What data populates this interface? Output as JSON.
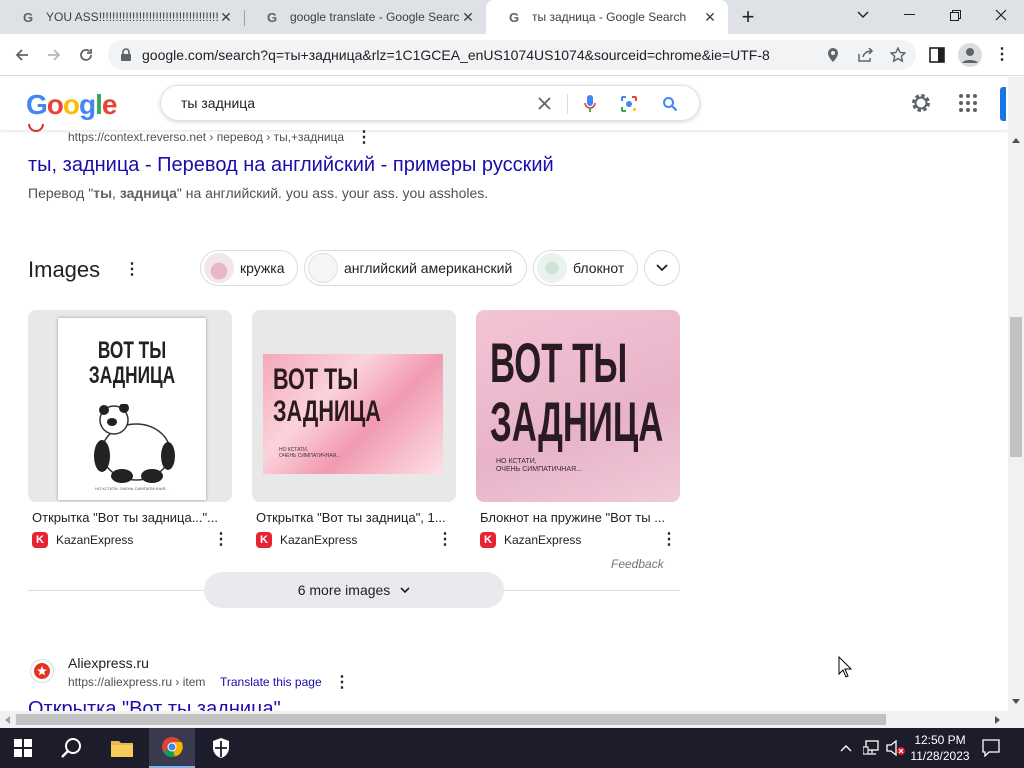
{
  "browser": {
    "tabs": [
      {
        "title": "YOU ASS!!!!!!!!!!!!!!!!!!!!!!!!!!!!!!!!!!!!!",
        "favicon": "G",
        "active": false
      },
      {
        "title": "google translate - Google Search",
        "favicon": "G",
        "active": false
      },
      {
        "title": "ты задница - Google Search",
        "favicon": "G",
        "active": true
      }
    ],
    "new_tab_label": "+",
    "url": "google.com/search?q=ты+задница&rlz=1C1GCEA_enUS1074US1074&sourceid=chrome&ie=UTF-8"
  },
  "google": {
    "logo": [
      "G",
      "o",
      "o",
      "g",
      "l",
      "e"
    ],
    "logo_colors": [
      "#4285F4",
      "#EA4335",
      "#FBBC05",
      "#4285F4",
      "#34A853",
      "#EA4335"
    ],
    "query": "ты задница"
  },
  "results": {
    "reverso": {
      "url": "https://context.reverso.net › перевод › ты,+задница",
      "title": "ты, задница - Перевод на английский - примеры русский",
      "snippet_pre": "Перевод \"",
      "snippet_b1": "ты",
      "snippet_mid": ", ",
      "snippet_b2": "задница",
      "snippet_post": "\" на английский. you ass. your ass. you assholes."
    },
    "images": {
      "heading": "Images",
      "chips": [
        "кружка",
        "английский американский",
        "блокнот"
      ],
      "cards": [
        {
          "caption": "Открытка \"Вот ты задница...\"...",
          "source": "KazanExpress",
          "art_line1": "ВОТ ТЫ",
          "art_line2": "ЗАДНИЦА"
        },
        {
          "caption": "Открытка \"Вот ты задница\", 1...",
          "source": "KazanExpress",
          "art_line1": "ВОТ ТЫ",
          "art_line2": "ЗАДНИЦА"
        },
        {
          "caption": "Блокнот на пружине \"Вот ты ...",
          "source": "KazanExpress",
          "art_line1": "ВОТ ТЫ",
          "art_line2": "ЗАДНИЦА"
        }
      ],
      "art_small_1": "НО КСТАТИ,",
      "art_small_2": "ОЧЕНЬ СИМПАТИЧНАЯ...",
      "feedback": "Feedback",
      "more_button": "6 more images"
    },
    "aliexpress": {
      "site": "Aliexpress.ru",
      "url": "https://aliexpress.ru › item",
      "translate": "Translate this page",
      "title": "Открытка \"Вот ты задница\""
    }
  },
  "taskbar": {
    "time": "12:50 PM",
    "date": "11/28/2023"
  }
}
